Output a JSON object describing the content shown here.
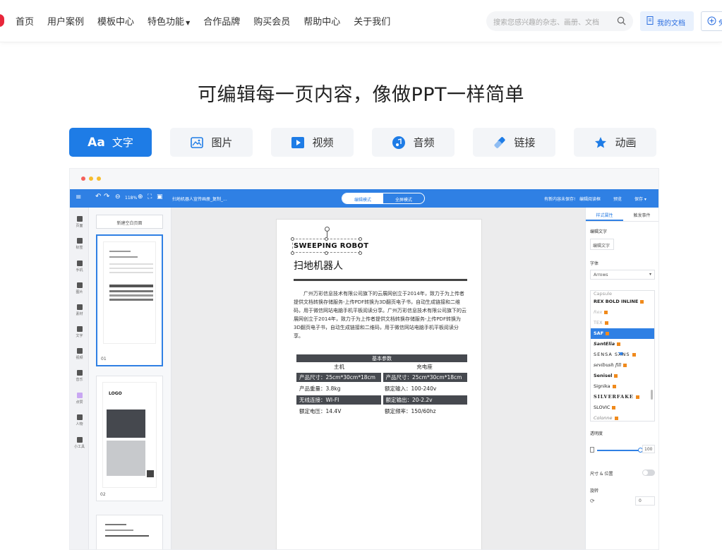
{
  "nav": {
    "links": [
      "首页",
      "用户案例",
      "模板中心",
      "特色功能",
      "合作品牌",
      "购买会员",
      "帮助中心",
      "关于我们"
    ],
    "search_placeholder": "搜索您感兴趣的杂志、画册、文档",
    "my_docs": "我的文档",
    "new_label": "免"
  },
  "headline": "可编辑每一页内容，像做PPT一样简单",
  "tabs": [
    {
      "label": "文字",
      "prefix": "Aa"
    },
    {
      "label": "图片"
    },
    {
      "label": "视频"
    },
    {
      "label": "音频"
    },
    {
      "label": "链接"
    },
    {
      "label": "动画"
    }
  ],
  "editor": {
    "zoom": "118%",
    "doc_title": "扫地机器人宣传画册_复制_...",
    "mode_edit": "编辑模式",
    "mode_preview": "全屏模式",
    "unsaved": "有新内容未保存!",
    "save_draft": "编辑阅读框",
    "preview": "预览",
    "save": "保存",
    "left_tools": [
      "页面",
      "标签",
      "手机",
      "图片",
      "素材",
      "文字",
      "视频",
      "音乐",
      "点赞",
      "人物",
      "小工具"
    ],
    "new_page": "新建空白页面",
    "page_nums": [
      "01",
      "02"
    ],
    "thumb2_logo": "LOGO"
  },
  "page": {
    "title_en": "SWEEPING ROBOT",
    "title_cn": "扫地机器人",
    "paragraph": "广州万彩信息技术有限公司旗下的云展网创立于2014年，致力于为上传者提供文档转换存储服务-上传PDF转换为3D翻页电子书，自动生成链接和二维码，用于微信网站电脑手机平板阅读分享。广州万彩信息技术有限公司旗下的云展网创立于2014年，致力于为上传者提供文档转换存储服务-上传PDF转换为3D翻页电子书，自动生成链接和二维码，用于微信网站电脑手机平板阅读分享。",
    "spec_header": "基本参数",
    "host": "主机",
    "dock": "充电座",
    "rows": [
      [
        "产品尺寸：25cm*30cm*18cm",
        "产品尺寸：25cm*30cm*18cm"
      ],
      [
        "产品重量：3.8kg",
        "额定输入：100-240v"
      ],
      [
        "无线连接：WI-FI",
        "额定输出：20-2.2v"
      ],
      [
        "额定电压：14.4V",
        "额定频率：150/60hz"
      ]
    ]
  },
  "rpanel": {
    "tab1": "样式属性",
    "tab2": "触发事件",
    "edit_text_label": "编辑文字",
    "edit_text_btn": "编辑文字",
    "font_label": "字体",
    "font_value": "Arrows",
    "fonts": [
      "Capsule",
      "REX BOLD INLINE",
      "Rex",
      "TEX",
      "SAF",
      "SantElia",
      "SENSA SANS",
      "sevibush fill",
      "Senisel",
      "Signika",
      "SILVERFAKE",
      "SLOVIC",
      "Colonne"
    ],
    "opacity_label": "透明度",
    "opacity_value": "100",
    "size_label": "尺寸 & 位置",
    "rotate_label": "旋转",
    "rotate_value": "0"
  },
  "colors": {
    "accent": "#1e7ce6",
    "editor_bar": "#2f80e4",
    "logo": "#e8263a"
  }
}
